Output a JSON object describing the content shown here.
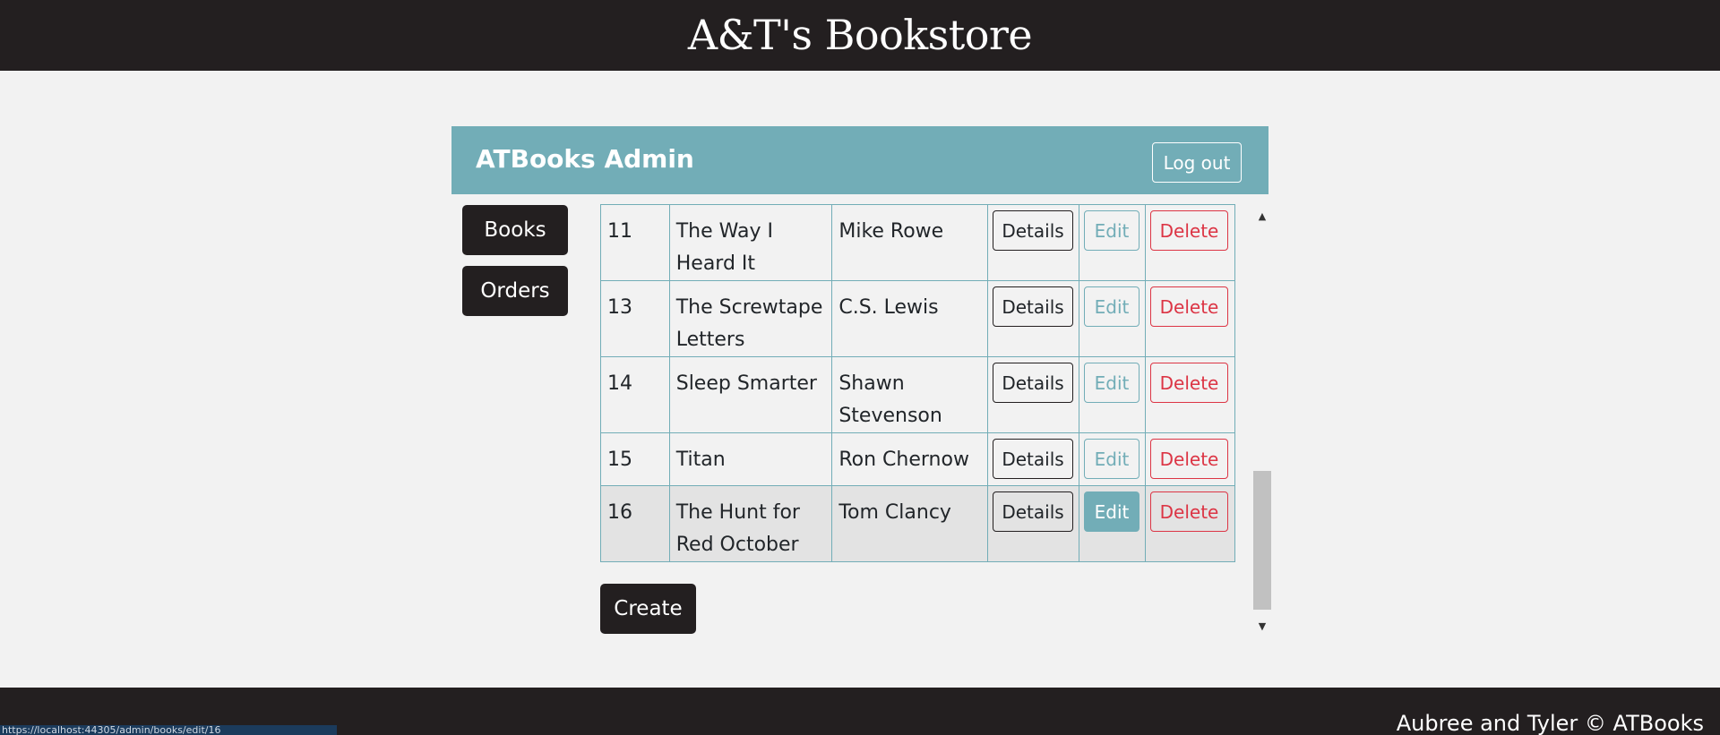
{
  "site": {
    "title": "A&T's Bookstore"
  },
  "admin": {
    "title": "ATBooks Admin",
    "logout_label": "Log out"
  },
  "sidebar": {
    "items": [
      {
        "label": "Books"
      },
      {
        "label": "Orders"
      }
    ]
  },
  "books": {
    "rows": [
      {
        "id": "11",
        "title": "The Way I Heard It",
        "author": "Mike Rowe",
        "details": "Details",
        "edit": "Edit",
        "delete": "Delete"
      },
      {
        "id": "13",
        "title": "The Screwtape Letters",
        "author": "C.S. Lewis",
        "details": "Details",
        "edit": "Edit",
        "delete": "Delete"
      },
      {
        "id": "14",
        "title": "Sleep Smarter",
        "author": "Shawn Stevenson",
        "details": "Details",
        "edit": "Edit",
        "delete": "Delete"
      },
      {
        "id": "15",
        "title": "Titan",
        "author": "Ron Chernow",
        "details": "Details",
        "edit": "Edit",
        "delete": "Delete"
      },
      {
        "id": "16",
        "title": "The Hunt for Red October",
        "author": "Tom Clancy",
        "details": "Details",
        "edit": "Edit",
        "delete": "Delete"
      }
    ],
    "create_label": "Create"
  },
  "scrollbar": {
    "up_icon": "▲",
    "down_icon": "▼"
  },
  "footer": {
    "text": "Aubree and Tyler © ATBooks"
  },
  "status_bar": {
    "url": "https://localhost:44305/admin/books/edit/16"
  }
}
